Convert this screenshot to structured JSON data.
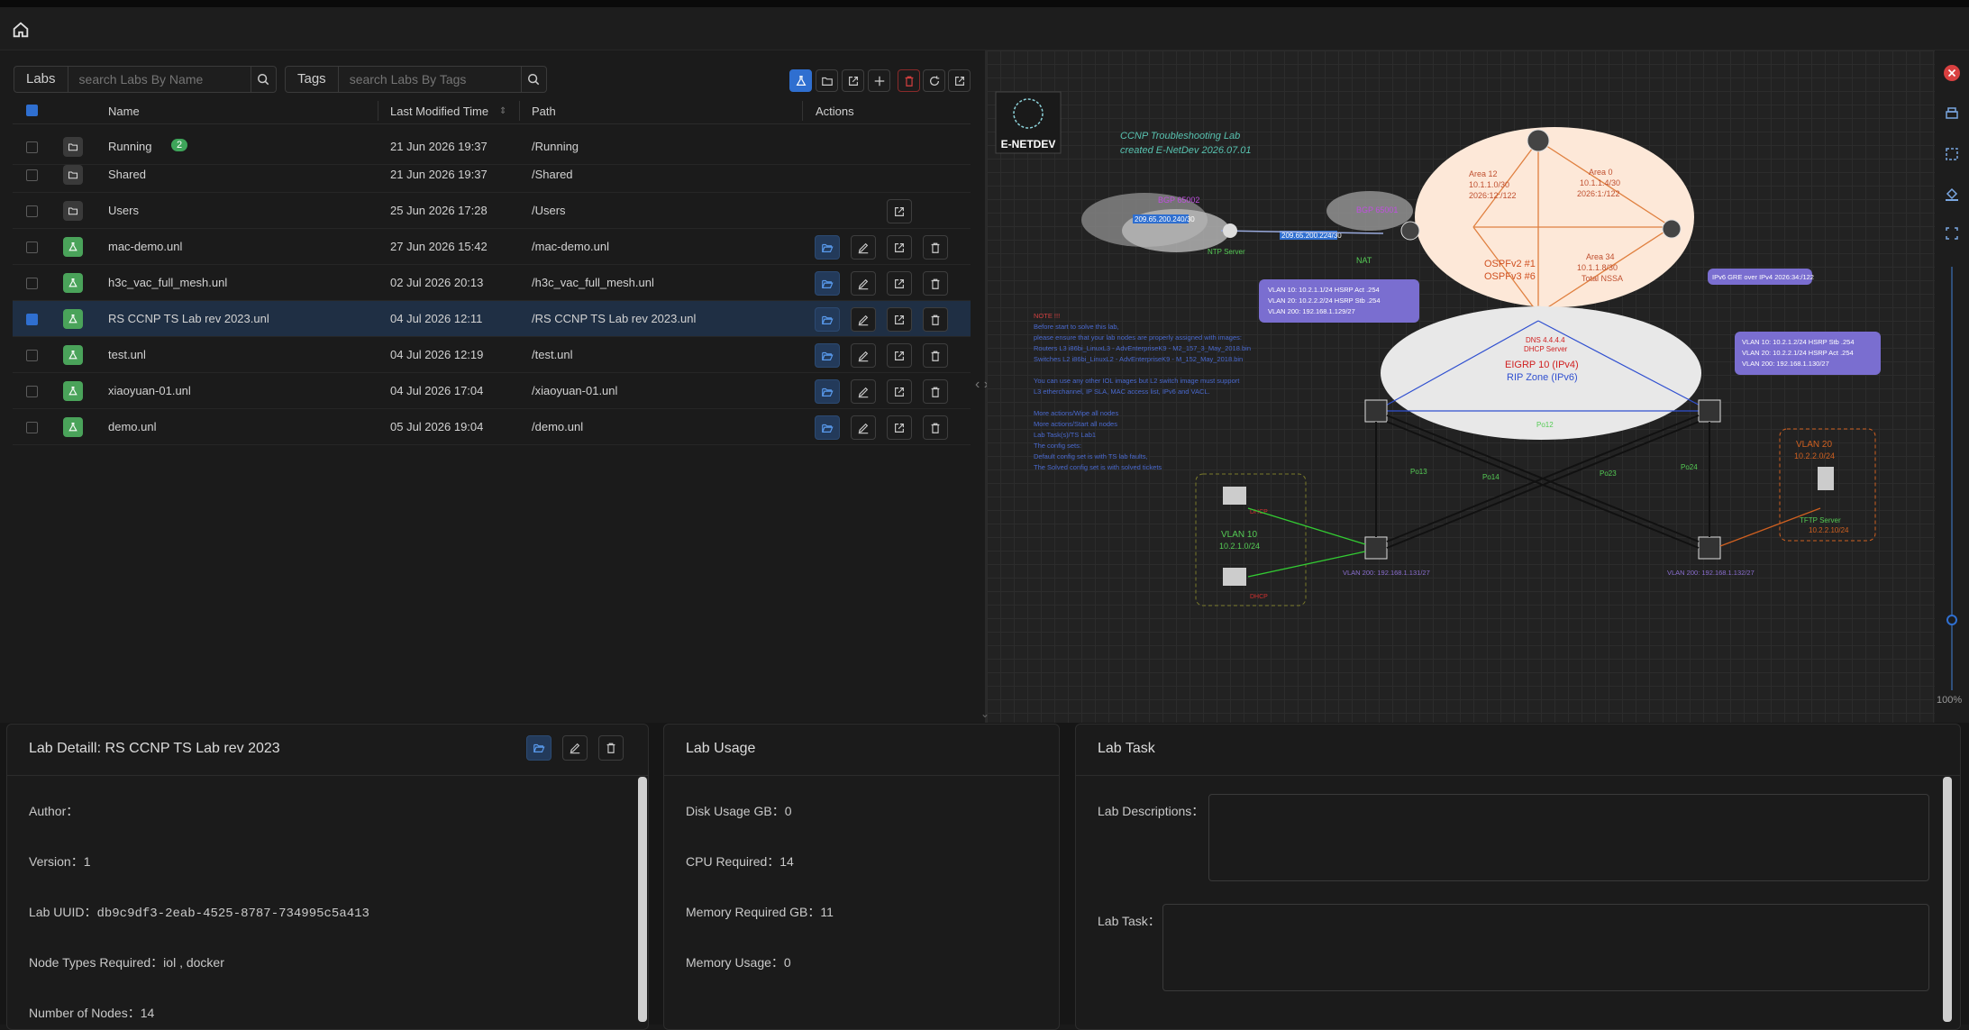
{
  "colors": {
    "accent": "#2f6fd0",
    "lab_icon": "#4aa35a",
    "running_badge": "#3ea55a",
    "close": "#d94040"
  },
  "nav": {
    "home_icon": "home-icon"
  },
  "labs_search": {
    "label": "Labs",
    "placeholder": "search Labs By Name"
  },
  "tags_search": {
    "label": "Tags",
    "placeholder": "search Labs By Tags"
  },
  "toolbar": {
    "icons": [
      "new-lab-icon",
      "new-folder-icon",
      "import-icon",
      "move-icon",
      "delete-icon",
      "refresh-icon",
      "export-icon"
    ]
  },
  "table": {
    "columns": {
      "name": "Name",
      "modified": "Last Modified Time",
      "path": "Path",
      "actions": "Actions"
    },
    "rows": [
      {
        "type": "folder",
        "name": "Running",
        "badge": "2",
        "time": "21 Jun 2026 19:37",
        "path": "/Running",
        "checked": false,
        "actions": []
      },
      {
        "type": "folder",
        "name": "Shared",
        "badge": "",
        "time": "21 Jun 2026 19:37",
        "path": "/Shared",
        "checked": false,
        "actions": []
      },
      {
        "type": "folder",
        "name": "Users",
        "badge": "",
        "time": "25 Jun 2026 17:28",
        "path": "/Users",
        "checked": false,
        "actions": [
          "export"
        ]
      },
      {
        "type": "lab",
        "name": "mac-demo.unl",
        "badge": "",
        "time": "27 Jun 2026 15:42",
        "path": "/mac-demo.unl",
        "checked": false,
        "actions": [
          "open",
          "edit",
          "export",
          "delete"
        ]
      },
      {
        "type": "lab",
        "name": "h3c_vac_full_mesh.unl",
        "badge": "",
        "time": "02 Jul 2026 20:13",
        "path": "/h3c_vac_full_mesh.unl",
        "checked": false,
        "actions": [
          "open",
          "edit",
          "export",
          "delete"
        ]
      },
      {
        "type": "lab",
        "name": "RS CCNP TS Lab rev 2023.unl",
        "badge": "",
        "time": "04 Jul 2026 12:11",
        "path": "/RS CCNP TS Lab rev 2023.unl",
        "checked": true,
        "actions": [
          "open",
          "edit",
          "export",
          "delete"
        ]
      },
      {
        "type": "lab",
        "name": "test.unl",
        "badge": "",
        "time": "04 Jul 2026 12:19",
        "path": "/test.unl",
        "checked": false,
        "actions": [
          "open",
          "edit",
          "export",
          "delete"
        ]
      },
      {
        "type": "lab",
        "name": "xiaoyuan-01.unl",
        "badge": "",
        "time": "04 Jul 2026 17:04",
        "path": "/xiaoyuan-01.unl",
        "checked": false,
        "actions": [
          "open",
          "edit",
          "export",
          "delete"
        ]
      },
      {
        "type": "lab",
        "name": "demo.unl",
        "badge": "",
        "time": "05 Jul 2026 19:04",
        "path": "/demo.unl",
        "checked": false,
        "actions": [
          "open",
          "edit",
          "export",
          "delete"
        ]
      }
    ]
  },
  "topology": {
    "logo": "E-NETDEV",
    "title_line1": "CCNP Troubleshooting Lab",
    "title_line2": "created  E-NetDev 2026.07.01",
    "bgp1": "BGP 65002",
    "bgp2": "BGP 65001",
    "ntp": "NTP Server",
    "nat": "NAT",
    "link_a": "209.65.200.240/30",
    "link_b": "209.65.200.224/30",
    "area12": "Area 12\n10.1.1.0/30\n2026:12:/122",
    "area0": "Area 0\n10.1.1.4/30\n2026:1:/122",
    "area34": "Area 34\n10.1.1.8/30\nTotal NSSA",
    "ospf": "OSPFv2 #1",
    "ospf3": "OSPFv3 #6",
    "ipv6gre": "IPv6 GRE over IPv4 2026:34:/122",
    "vlan_left": [
      "VLAN 10: 10.2.1.1/24 HSRP Act .254",
      "VLAN 20: 10.2.2.2/24 HSRP Stb .254",
      "VLAN 200: 192.168.1.129/27"
    ],
    "vlan_right": [
      "VLAN 10: 10.2.1.2/24 HSRP Stb .254",
      "VLAN 20: 10.2.2.1/24 HSRP Act .254",
      "VLAN 200: 192.168.1.130/27"
    ],
    "eigrp": "EIGRP 10 (IPv4)",
    "rip": "RIP Zone (IPv6)",
    "dhcp": "DNS 4.4.4.4\nDHCP Server",
    "note_title": "NOTE !!!",
    "notes": [
      "Before start to solve this lab,",
      "please ensure that your lab nodes are properly assigned with images:",
      "Routers L3 i86bi_LinuxL3 - AdvEnterpriseK9 - M2_157_3_May_2018.bin",
      "Switches L2 i86bi_LinuxL2 - AdvEnterpriseK9 - M_152_May_2018.bin",
      "",
      "You can use any other IOL images but L2 switch image must support",
      "L3 etherchannel, IP SLA, MAC access list, IPv6 and VACL.",
      "",
      "More actions/Wipe all nodes",
      "More actions/Start all nodes",
      "Lab Task(s)/TS Lab1",
      "The config sets:",
      "Default config set is with TS lab faults,",
      "The Solved config set is with solved tickets"
    ],
    "vlan10": "VLAN 10\n10.2.1.0/24",
    "vlan20": "VLAN 20\n10.2.2.0/24",
    "tftp": "TFTP Server\n10.2.2.10/24",
    "po": [
      "Po13",
      "Po14",
      "Po23",
      "Po24",
      "Po12"
    ],
    "asw_vlan": "VLAN 200: 192.168.1.131/27",
    "asw_vlan2": "VLAN 200: 192.168.1.132/27",
    "dhcp_lbl": "DHCP",
    "zoom": "100%"
  },
  "side_icons": [
    "close-icon",
    "print-icon",
    "select-icon",
    "fill-icon",
    "screenshot-icon"
  ],
  "detail": {
    "title": "Lab Detaill: RS CCNP TS Lab rev 2023",
    "author_label": "Author：",
    "version_label": "Version：",
    "version": "1",
    "uuid_label": "Lab UUID：",
    "uuid": "db9c9df3-2eab-4525-8787-734995c5a413",
    "node_types_label": "Node Types Required：",
    "node_types": "iol , docker",
    "nodes_label": "Number of Nodes：",
    "nodes": "14"
  },
  "usage": {
    "title": "Lab Usage",
    "disk_label": "Disk Usage GB：",
    "disk": "0",
    "cpu_label": "CPU Required：",
    "cpu": "14",
    "mem_req_label": "Memory Required GB：",
    "mem_req": "11",
    "mem_use_label": "Memory Usage：",
    "mem_use": "0"
  },
  "task": {
    "title": "Lab Task",
    "desc_label": "Lab Descriptions：",
    "task_label": "Lab Task："
  }
}
